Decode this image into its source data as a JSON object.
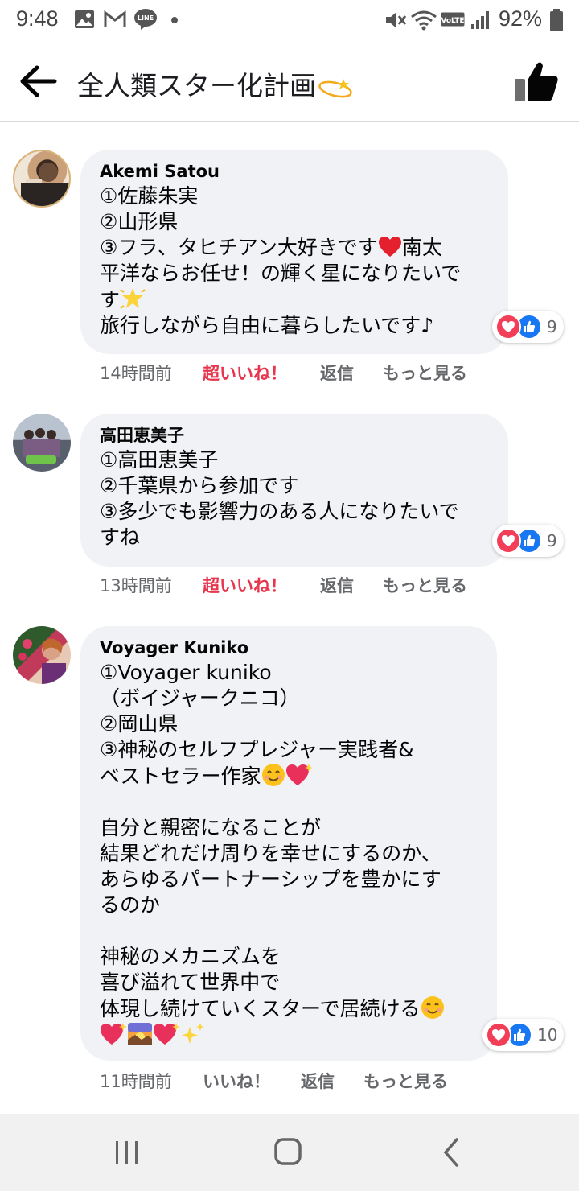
{
  "status_bar": {
    "time": "9:48",
    "battery": "92%",
    "left_icons": [
      "image-icon",
      "gmail-icon",
      "line-icon",
      "dot-icon"
    ],
    "right_icons": [
      "mute-icon",
      "wifi-icon",
      "volte-icon",
      "signal-icon",
      "battery-icon"
    ],
    "volte_label": "VoLTE"
  },
  "header": {
    "title": "全人類スター化計画"
  },
  "comments": [
    {
      "author": "Akemi Satou",
      "lines": [
        "①佐藤朱実",
        "②山形県",
        "③フラ、タヒチアン大好きです",
        "南太",
        "平洋ならお任せ！の輝く星になりたいで",
        "す",
        "旅行しながら自由に暮らしたいです♪"
      ],
      "reaction_count": "9",
      "time": "14時間前",
      "reaction_label": "超いいね！",
      "reply": "返信",
      "more": "もっと見る"
    },
    {
      "author": "高田恵美子",
      "lines": [
        "①高田恵美子",
        "②千葉県から参加です",
        "③多少でも影響力のある人になりたいで",
        "すね"
      ],
      "reaction_count": "9",
      "time": "13時間前",
      "reaction_label": "超いいね！",
      "reply": "返信",
      "more": "もっと見る"
    },
    {
      "author": "Voyager Kuniko",
      "lines": [
        "①Voyager kuniko",
        "（ボイジャークニコ）",
        "②岡山県",
        "③神秘のセルフプレジャー実践者&",
        "ベストセラー作家",
        "自分と親密になることが",
        "結果どれだけ周りを幸せにするのか、",
        "あらゆるパートナーシップを豊かにす",
        "るのか",
        "神秘のメカニズムを",
        "喜び溢れて世界中で",
        "体現し続けていくスターで居続ける"
      ],
      "reaction_count": "10",
      "time": "11時間前",
      "reaction_label": "いいね！",
      "reply": "返信",
      "more": "もっと見る"
    }
  ],
  "nav": {
    "icons": [
      "recent-apps-icon",
      "home-icon",
      "back-nav-icon"
    ]
  },
  "colors": {
    "bubble": "#f0f2f5",
    "love_red": "#e8354e",
    "heart": "#f33e58",
    "like_blue": "#1877f2",
    "meta_gray": "#65676b"
  }
}
